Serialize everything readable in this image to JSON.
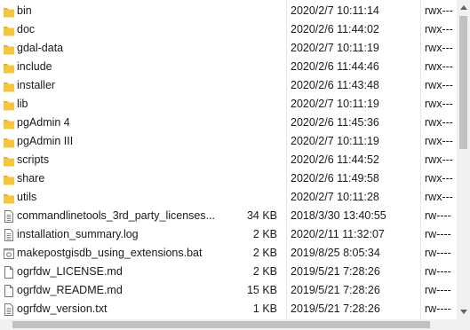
{
  "colors": {
    "folder": "#f4c542",
    "folder_tab": "#dfa92a",
    "file_border": "#777777"
  },
  "files": [
    {
      "name": "bin",
      "size": "",
      "date": "2020/2/7 10:11:14",
      "perm": "rwx---",
      "icon": "folder-icon"
    },
    {
      "name": "doc",
      "size": "",
      "date": "2020/2/6 11:44:02",
      "perm": "rwx---",
      "icon": "folder-icon"
    },
    {
      "name": "gdal-data",
      "size": "",
      "date": "2020/2/7 10:11:19",
      "perm": "rwx---",
      "icon": "folder-icon"
    },
    {
      "name": "include",
      "size": "",
      "date": "2020/2/6 11:44:46",
      "perm": "rwx---",
      "icon": "folder-icon"
    },
    {
      "name": "installer",
      "size": "",
      "date": "2020/2/6 11:43:48",
      "perm": "rwx---",
      "icon": "folder-icon"
    },
    {
      "name": "lib",
      "size": "",
      "date": "2020/2/7 10:11:19",
      "perm": "rwx---",
      "icon": "folder-icon"
    },
    {
      "name": "pgAdmin 4",
      "size": "",
      "date": "2020/2/6 11:45:36",
      "perm": "rwx---",
      "icon": "folder-icon"
    },
    {
      "name": "pgAdmin III",
      "size": "",
      "date": "2020/2/7 10:11:19",
      "perm": "rwx---",
      "icon": "folder-icon"
    },
    {
      "name": "scripts",
      "size": "",
      "date": "2020/2/6 11:44:52",
      "perm": "rwx---",
      "icon": "folder-icon"
    },
    {
      "name": "share",
      "size": "",
      "date": "2020/2/6 11:49:58",
      "perm": "rwx---",
      "icon": "folder-icon"
    },
    {
      "name": "utils",
      "size": "",
      "date": "2020/2/7 10:11:28",
      "perm": "rwx---",
      "icon": "folder-icon"
    },
    {
      "name": "commandlinetools_3rd_party_licenses...",
      "size": "34 KB",
      "date": "2018/3/30 13:40:55",
      "perm": "rw----",
      "icon": "text-file-icon"
    },
    {
      "name": "installation_summary.log",
      "size": "2 KB",
      "date": "2020/2/11 11:32:07",
      "perm": "rw----",
      "icon": "text-file-icon"
    },
    {
      "name": "makepostgisdb_using_extensions.bat",
      "size": "2 KB",
      "date": "2019/8/25 8:05:34",
      "perm": "rw----",
      "icon": "batch-file-icon"
    },
    {
      "name": "ogrfdw_LICENSE.md",
      "size": "2 KB",
      "date": "2019/5/21 7:28:26",
      "perm": "rw----",
      "icon": "file-icon"
    },
    {
      "name": "ogrfdw_README.md",
      "size": "15 KB",
      "date": "2019/5/21 7:28:26",
      "perm": "rw----",
      "icon": "file-icon"
    },
    {
      "name": "ogrfdw_version.txt",
      "size": "1 KB",
      "date": "2019/5/21 7:28:26",
      "perm": "rw----",
      "icon": "text-file-icon"
    }
  ]
}
